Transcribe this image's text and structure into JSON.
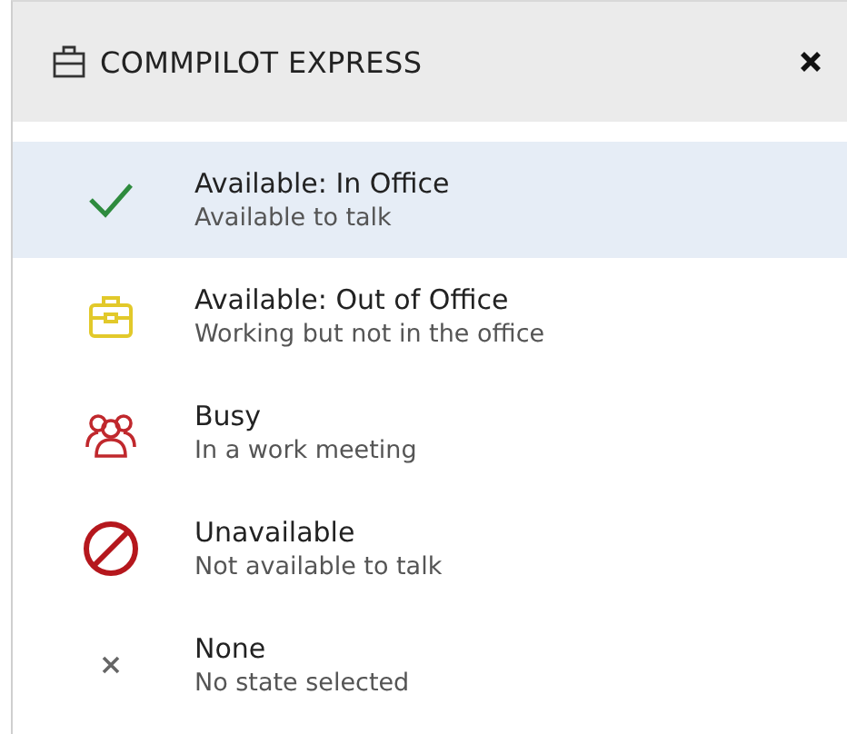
{
  "header": {
    "title": "COMMPILOT EXPRESS"
  },
  "states": [
    {
      "kind": "check",
      "title": "Available: In Office",
      "subtitle": "Available to talk",
      "selected": true
    },
    {
      "kind": "briefcase",
      "title": "Available: Out of Office",
      "subtitle": "Working but not in the office",
      "selected": false
    },
    {
      "kind": "people",
      "title": "Busy",
      "subtitle": "In a work meeting",
      "selected": false
    },
    {
      "kind": "blocked",
      "title": "Unavailable",
      "subtitle": "Not available to talk",
      "selected": false
    },
    {
      "kind": "none",
      "title": "None",
      "subtitle": "No state selected",
      "selected": false
    }
  ]
}
